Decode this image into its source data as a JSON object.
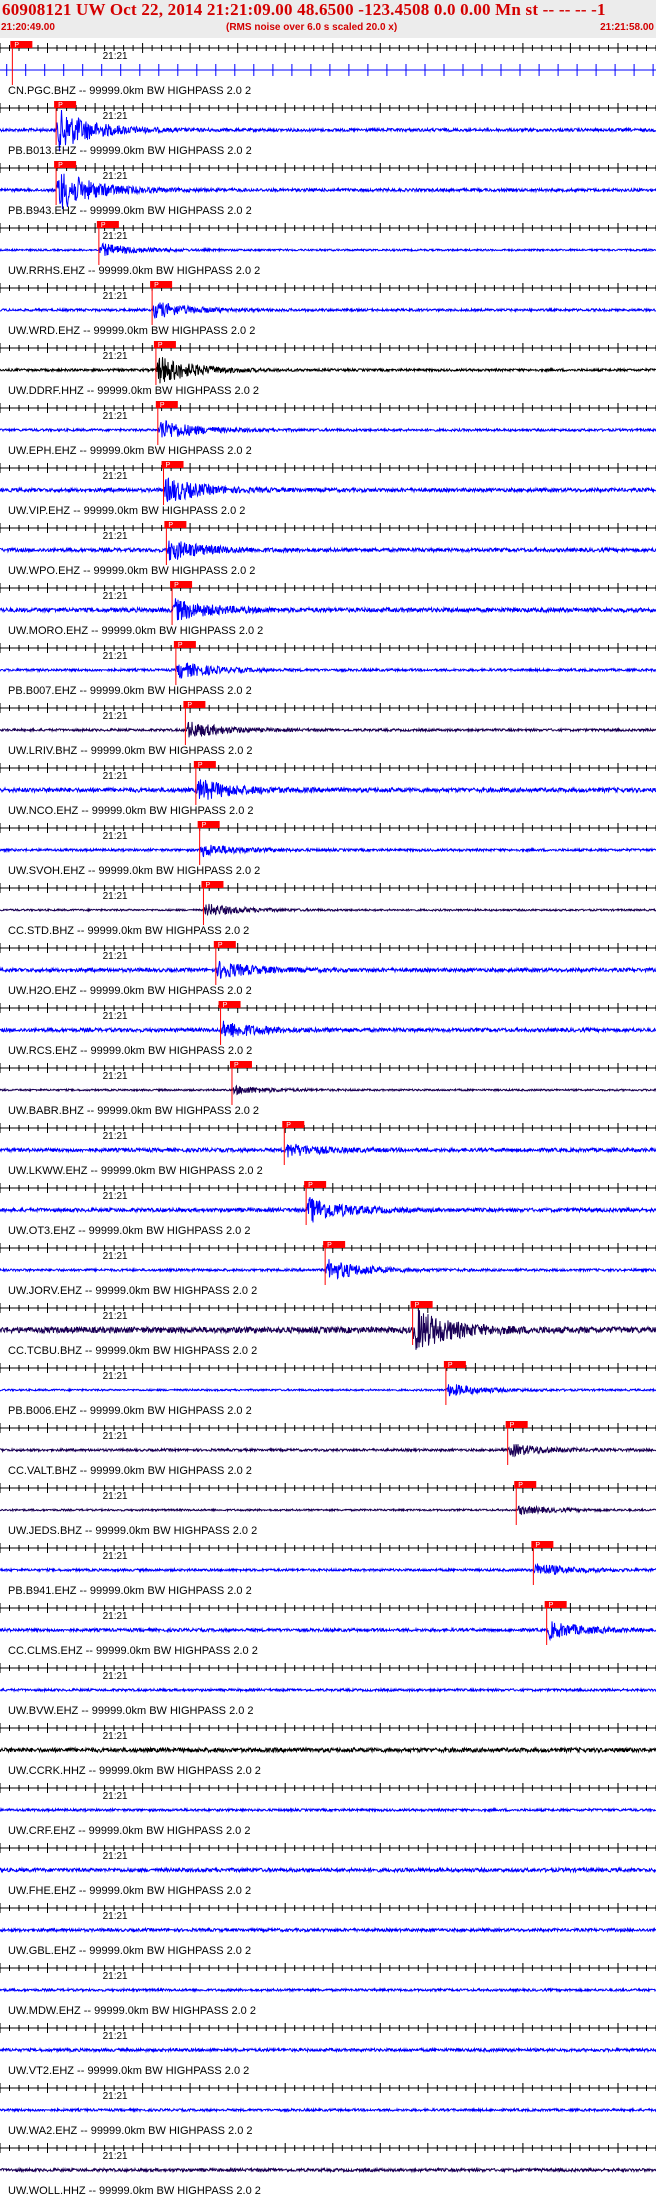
{
  "header": {
    "title": "60908121 UW Oct 22, 2014 21:21:09.00   48.6500 -123.4508  0.0 0.00 Mn st -- -- -- -1",
    "start_time": "21:20:49.00",
    "end_time": "21:21:58.00",
    "note": "(RMS noise over 6.0 s scaled 20.0 x)"
  },
  "chart_data": {
    "type": "line",
    "time_range_s": [
      0,
      69
    ],
    "minute_marker_s": 11.0,
    "minute_label": "21:21",
    "colors": {
      "trace": "#0000ff",
      "trace_dark": "#1a0055",
      "pick": "#ff0000",
      "axis": "#000000"
    },
    "traces": [
      {
        "label": "CN.PGC.BHZ -- 99999.0km BW  HIGHPASS  2.0  2",
        "pick_s": 1.3,
        "pick_label": "P",
        "color": "#0000ff",
        "noise": 0.0,
        "event": 0.0,
        "spikes": true
      },
      {
        "label": "PB.B013.EHZ -- 99999.0km BW  HIGHPASS  2.0  2",
        "pick_s": 5.9,
        "pick_label": "P",
        "color": "#0000ff",
        "noise": 0.25,
        "event": 1.0
      },
      {
        "label": "PB.B943.EHZ -- 99999.0km BW  HIGHPASS  2.0  2",
        "pick_s": 5.9,
        "pick_label": "P",
        "color": "#0000ff",
        "noise": 0.25,
        "event": 1.0
      },
      {
        "label": "UW.RRHS.EHZ -- 99999.0km BW  HIGHPASS  2.0  2",
        "pick_s": 10.4,
        "pick_label": "P",
        "color": "#0000ff",
        "noise": 0.15,
        "event": 0.3
      },
      {
        "label": "UW.WRD.EHZ -- 99999.0km BW  HIGHPASS  2.0  2",
        "pick_s": 16.0,
        "pick_label": "P",
        "color": "#0000ff",
        "noise": 0.2,
        "event": 0.4
      },
      {
        "label": "UW.DDRF.HHZ -- 99999.0km BW  HIGHPASS  2.0  2",
        "pick_s": 16.4,
        "pick_label": "P",
        "color": "#000000",
        "noise": 0.2,
        "event": 0.7
      },
      {
        "label": "UW.EPH.EHZ -- 99999.0km BW  HIGHPASS  2.0  2",
        "pick_s": 16.6,
        "pick_label": "P",
        "color": "#0000ff",
        "noise": 0.2,
        "event": 0.5
      },
      {
        "label": "UW.VIP.EHZ -- 99999.0km BW  HIGHPASS  2.0  2",
        "pick_s": 17.2,
        "pick_label": "P",
        "color": "#0000ff",
        "noise": 0.3,
        "event": 0.6
      },
      {
        "label": "UW.WPO.EHZ -- 99999.0km BW  HIGHPASS  2.0  2",
        "pick_s": 17.5,
        "pick_label": "P",
        "color": "#0000ff",
        "noise": 0.3,
        "event": 0.5
      },
      {
        "label": "UW.MORO.EHZ -- 99999.0km BW  HIGHPASS  2.0  2",
        "pick_s": 18.1,
        "pick_label": "P",
        "color": "#0000ff",
        "noise": 0.35,
        "event": 0.5
      },
      {
        "label": "PB.B007.EHZ -- 99999.0km BW  HIGHPASS  2.0  2",
        "pick_s": 18.5,
        "pick_label": "P",
        "color": "#0000ff",
        "noise": 0.2,
        "event": 0.4
      },
      {
        "label": "UW.LRIV.BHZ -- 99999.0km BW  HIGHPASS  2.0  2",
        "pick_s": 19.5,
        "pick_label": "P",
        "color": "#1a0055",
        "noise": 0.2,
        "event": 0.4
      },
      {
        "label": "UW.NCO.EHZ -- 99999.0km BW  HIGHPASS  2.0  2",
        "pick_s": 20.6,
        "pick_label": "P",
        "color": "#0000ff",
        "noise": 0.35,
        "event": 0.5
      },
      {
        "label": "UW.SVOH.EHZ -- 99999.0km BW  HIGHPASS  2.0  2",
        "pick_s": 21.0,
        "pick_label": "P",
        "color": "#0000ff",
        "noise": 0.2,
        "event": 0.3
      },
      {
        "label": "CC.STD.BHZ -- 99999.0km BW  HIGHPASS  2.0  2",
        "pick_s": 21.4,
        "pick_label": "P",
        "color": "#1a0055",
        "noise": 0.15,
        "event": 0.3
      },
      {
        "label": "UW.H2O.EHZ -- 99999.0km BW  HIGHPASS  2.0  2",
        "pick_s": 22.7,
        "pick_label": "P",
        "color": "#0000ff",
        "noise": 0.3,
        "event": 0.4
      },
      {
        "label": "UW.RCS.EHZ -- 99999.0km BW  HIGHPASS  2.0  2",
        "pick_s": 23.2,
        "pick_label": "P",
        "color": "#0000ff",
        "noise": 0.3,
        "event": 0.4
      },
      {
        "label": "UW.BABR.BHZ -- 99999.0km BW  HIGHPASS  2.0  2",
        "pick_s": 24.4,
        "pick_label": "P",
        "color": "#1a0055",
        "noise": 0.15,
        "event": 0.2
      },
      {
        "label": "UW.LKWW.EHZ -- 99999.0km BW  HIGHPASS  2.0  2",
        "pick_s": 29.9,
        "pick_label": "P",
        "color": "#0000ff",
        "noise": 0.3,
        "event": 0.3
      },
      {
        "label": "UW.OT3.EHZ -- 99999.0km BW  HIGHPASS  2.0  2",
        "pick_s": 32.2,
        "pick_label": "P",
        "color": "#0000ff",
        "noise": 0.3,
        "event": 0.6
      },
      {
        "label": "UW.JORV.EHZ -- 99999.0km BW  HIGHPASS  2.0  2",
        "pick_s": 34.2,
        "pick_label": "P",
        "color": "#0000ff",
        "noise": 0.2,
        "event": 0.5
      },
      {
        "label": "CC.TCBU.BHZ -- 99999.0km BW  HIGHPASS  2.0  2",
        "pick_s": 43.4,
        "pick_label": "P",
        "color": "#1a0055",
        "noise": 0.5,
        "event": 1.0
      },
      {
        "label": "PB.B006.EHZ -- 99999.0km BW  HIGHPASS  2.0  2",
        "pick_s": 46.9,
        "pick_label": "P",
        "color": "#0000ff",
        "noise": 0.15,
        "event": 0.3
      },
      {
        "label": "CC.VALT.BHZ -- 99999.0km BW  HIGHPASS  2.0  2",
        "pick_s": 53.4,
        "pick_label": "P",
        "color": "#1a0055",
        "noise": 0.2,
        "event": 0.3
      },
      {
        "label": "UW.JEDS.BHZ -- 99999.0km BW  HIGHPASS  2.0  2",
        "pick_s": 54.3,
        "pick_label": "P",
        "color": "#1a0055",
        "noise": 0.15,
        "event": 0.2
      },
      {
        "label": "PB.B941.EHZ -- 99999.0km BW  HIGHPASS  2.0  2",
        "pick_s": 56.1,
        "pick_label": "P",
        "color": "#0000ff",
        "noise": 0.2,
        "event": 0.3
      },
      {
        "label": "CC.CLMS.EHZ -- 99999.0km BW  HIGHPASS  2.0  2",
        "pick_s": 57.5,
        "pick_label": "P",
        "color": "#0000ff",
        "noise": 0.25,
        "event": 0.4
      },
      {
        "label": "UW.BVW.EHZ -- 99999.0km BW  HIGHPASS  2.0  2",
        "pick_s": null,
        "color": "#0000ff",
        "noise": 0.2,
        "event": 0
      },
      {
        "label": "UW.CCRK.HHZ -- 99999.0km BW  HIGHPASS  2.0  2",
        "pick_s": null,
        "color": "#000000",
        "noise": 0.35,
        "event": 0
      },
      {
        "label": "UW.CRF.EHZ -- 99999.0km BW  HIGHPASS  2.0  2",
        "pick_s": null,
        "color": "#0000ff",
        "noise": 0.2,
        "event": 0
      },
      {
        "label": "UW.FHE.EHZ -- 99999.0km BW  HIGHPASS  2.0  2",
        "pick_s": null,
        "color": "#0000ff",
        "noise": 0.3,
        "event": 0
      },
      {
        "label": "UW.GBL.EHZ -- 99999.0km BW  HIGHPASS  2.0  2",
        "pick_s": null,
        "color": "#0000ff",
        "noise": 0.25,
        "event": 0
      },
      {
        "label": "UW.MDW.EHZ -- 99999.0km BW  HIGHPASS  2.0  2",
        "pick_s": null,
        "color": "#0000ff",
        "noise": 0.2,
        "event": 0
      },
      {
        "label": "UW.VT2.EHZ -- 99999.0km BW  HIGHPASS  2.0  2",
        "pick_s": null,
        "color": "#0000ff",
        "noise": 0.25,
        "event": 0
      },
      {
        "label": "UW.WA2.EHZ -- 99999.0km BW  HIGHPASS  2.0  2",
        "pick_s": null,
        "color": "#0000ff",
        "noise": 0.2,
        "event": 0
      },
      {
        "label": "UW.WOLL.HHZ -- 99999.0km BW  HIGHPASS  2.0  2",
        "pick_s": null,
        "color": "#1a0055",
        "noise": 0.25,
        "event": 0
      }
    ]
  }
}
